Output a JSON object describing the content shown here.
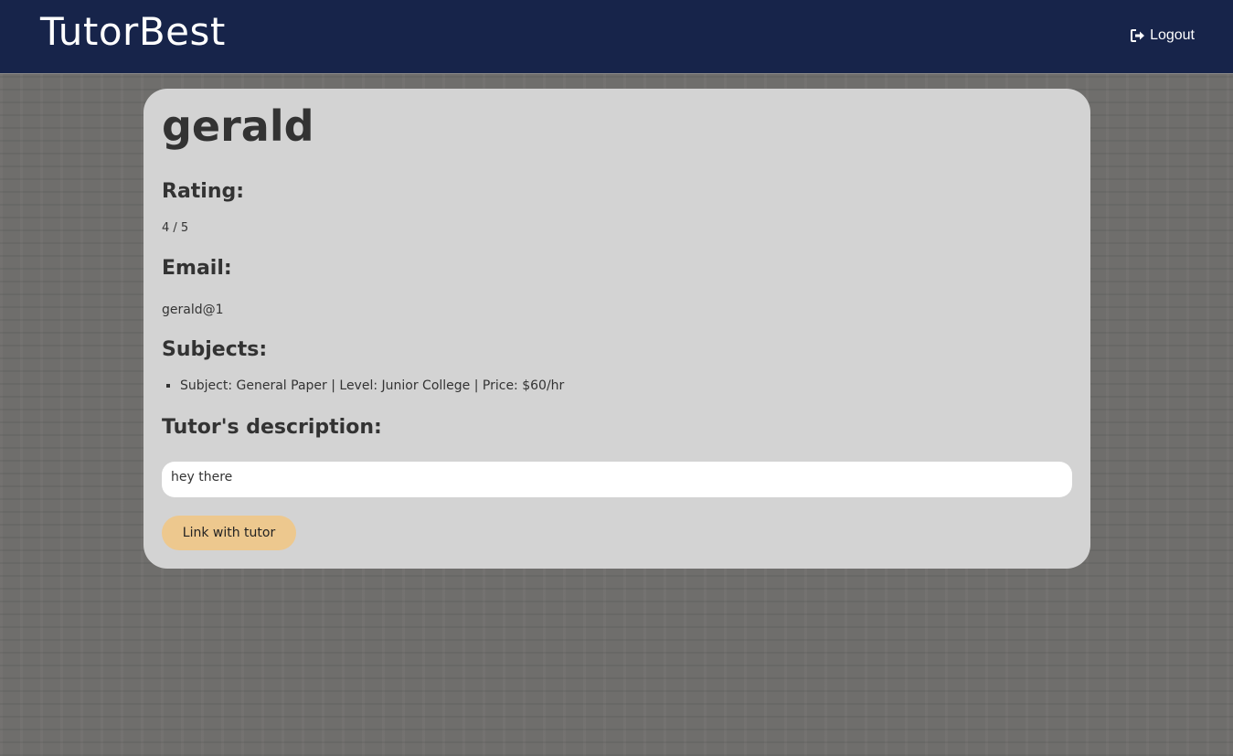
{
  "navbar": {
    "brand": "TutorBest",
    "logout_label": "Logout",
    "background": "#17244a",
    "logout_icon": "sign-out-icon"
  },
  "tutor": {
    "name": "gerald",
    "rating_heading": "Rating:",
    "rating_value": "4 / 5",
    "email_heading": "Email:",
    "email_value": "gerald@1",
    "subjects_heading": "Subjects:",
    "subjects": [
      "Subject: General Paper | Level: Junior College | Price: $60/hr"
    ],
    "description_heading": "Tutor's description:",
    "description": "hey there",
    "link_button_label": "Link with tutor"
  },
  "colors": {
    "card_background": "#d3d3d3",
    "button_accent": "#edc88e",
    "page_background": "#6f6e6c"
  }
}
